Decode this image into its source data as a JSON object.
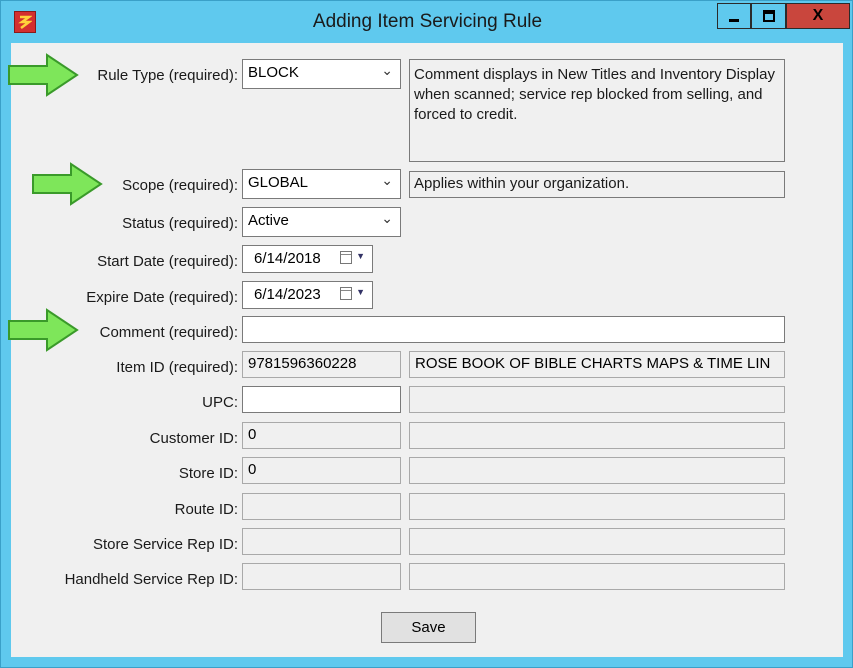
{
  "window": {
    "title": "Adding Item Servicing Rule",
    "minimize_glyph": "—",
    "maximize_glyph": "▢",
    "close_glyph": "X"
  },
  "form": {
    "rule_type": {
      "label": "Rule Type (required):",
      "value": "BLOCK",
      "description": "Comment displays in New Titles and Inventory Display when scanned; service rep blocked from selling, and forced to credit."
    },
    "scope": {
      "label": "Scope (required):",
      "value": "GLOBAL",
      "description": "Applies within your organization."
    },
    "status": {
      "label": "Status (required):",
      "value": "Active"
    },
    "start_date": {
      "label": "Start Date (required):",
      "value": "6/14/2018"
    },
    "expire_date": {
      "label": "Expire Date (required):",
      "value": "6/14/2023"
    },
    "comment": {
      "label": "Comment (required):",
      "value": ""
    },
    "item_id": {
      "label": "Item ID (required):",
      "value": "9781596360228",
      "description": "ROSE BOOK OF BIBLE CHARTS MAPS & TIME LIN"
    },
    "upc": {
      "label": "UPC:",
      "value": "",
      "description": ""
    },
    "customer_id": {
      "label": "Customer ID:",
      "value": "0",
      "description": ""
    },
    "store_id": {
      "label": "Store ID:",
      "value": "0",
      "description": ""
    },
    "route_id": {
      "label": "Route ID:",
      "value": "",
      "description": ""
    },
    "store_service_rep_id": {
      "label": "Store Service Rep ID:",
      "value": "",
      "description": ""
    },
    "handheld_service_rep_id": {
      "label": "Handheld Service Rep ID:",
      "value": "",
      "description": ""
    }
  },
  "buttons": {
    "save": "Save"
  },
  "icons": {
    "select_arrow": "chevron-down-icon",
    "calendar": "calendar-icon",
    "highlight": "green-arrow-icon"
  },
  "colors": {
    "title_bar": "#5fc9ee",
    "close_button": "#c9463d",
    "arrow_fill": "#7ee65a",
    "arrow_stroke": "#3a9a2a"
  }
}
